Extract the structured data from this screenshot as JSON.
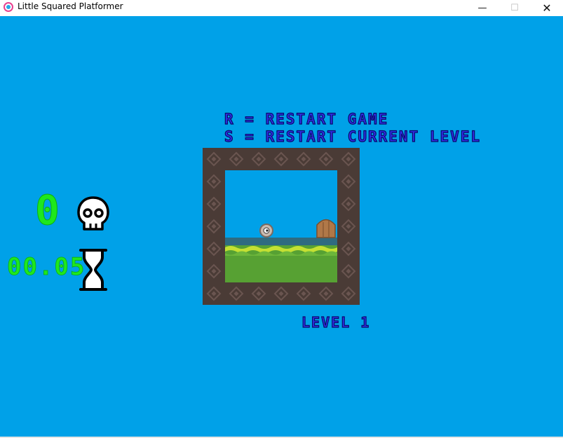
{
  "window": {
    "title": "Little Squared Platformer",
    "minimize": "—",
    "maximize": "☐",
    "close": "✕"
  },
  "hud": {
    "death_count": "0",
    "timer": "00.05",
    "icons": [
      "skull-icon",
      "hourglass-icon"
    ]
  },
  "instructions": {
    "restart_game": "R = RESTART GAME",
    "restart_level": "S = RESTART CURRENT LEVEL"
  },
  "level": {
    "label": "LEVEL 1",
    "entities": [
      "player",
      "exit-door"
    ]
  },
  "colors": {
    "background": "#00a1e8",
    "frame": "#4a3b36",
    "frame_diamond": "#6a5550",
    "sky": "#00a1e8",
    "ledge": "#2f6b80",
    "grass": "#57a133",
    "grass_highlight": "#c4e033",
    "counter_green": "#1ee81e",
    "pixel_text": "#2f2fe6",
    "door": "#b07848"
  }
}
